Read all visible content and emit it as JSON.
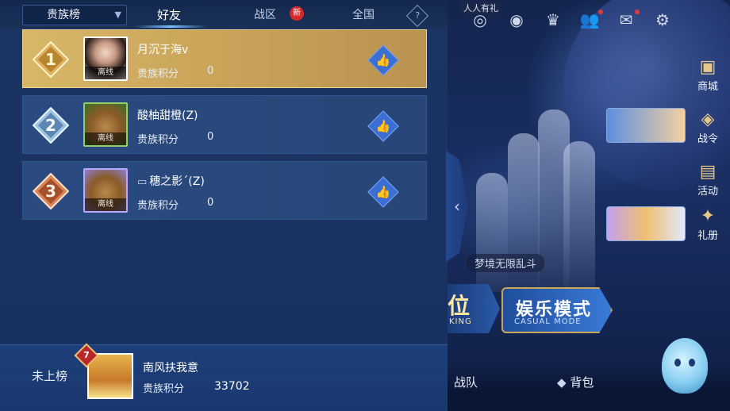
{
  "tabs": {
    "dropdown": "贵族榜",
    "items": [
      {
        "label": "好友",
        "active": true
      },
      {
        "label": "战区",
        "badge": "新"
      },
      {
        "label": "全国"
      }
    ],
    "help_icon": "question-diamond-icon"
  },
  "leaderboard": {
    "rows": [
      {
        "rank": "1",
        "name": "月沉于海v",
        "status": "离线",
        "score_label": "贵族积分",
        "score": "0",
        "medal": "gold"
      },
      {
        "rank": "2",
        "name": "酸柚甜橙(Z)",
        "status": "离线",
        "score_label": "贵族积分",
        "score": "0",
        "medal": "silver"
      },
      {
        "rank": "3",
        "name": "穗之影´(Z)",
        "status": "离线",
        "score_label": "贵族积分",
        "score": "0",
        "medal": "bronze"
      }
    ]
  },
  "self": {
    "rank_label": "未上榜",
    "level": "7",
    "name": "南风扶我意",
    "score_label": "贵族积分",
    "score": "33702"
  },
  "lobby": {
    "top_tag": "人人有礼",
    "side_buttons": [
      "商城",
      "战令",
      "活动",
      "礼册"
    ],
    "mode_label": "梦境无限乱斗",
    "rank_button": {
      "title": "位",
      "subtitle": "KING"
    },
    "casual_button": {
      "title": "娱乐模式",
      "subtitle": "CASUAL MODE"
    },
    "bottom_items": [
      "战队",
      "背包"
    ]
  },
  "colors": {
    "panel_bg": "#1c3461",
    "gold_row": "#d8b768",
    "like_button": "#3b6fd4",
    "new_badge": "#d42a2a"
  }
}
